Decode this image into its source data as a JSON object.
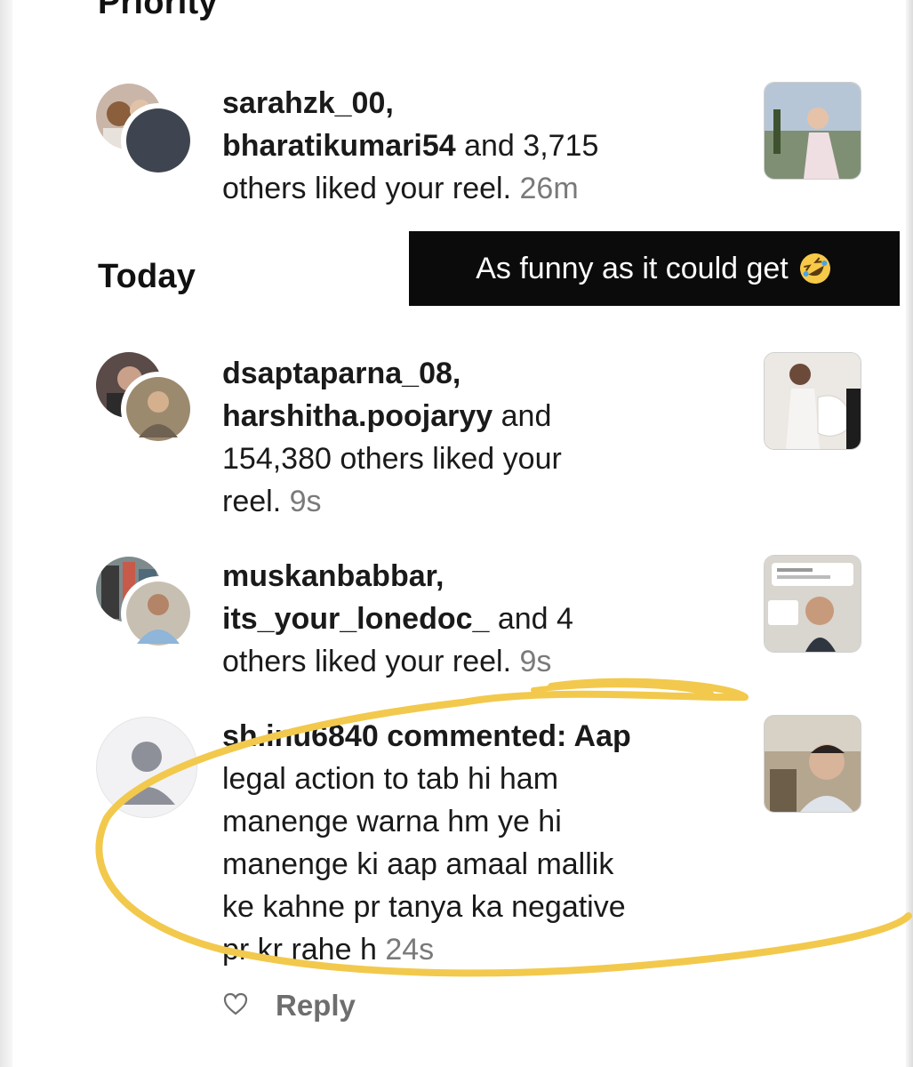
{
  "sections": {
    "priority_title": "Priority",
    "today_title": "Today"
  },
  "caption": {
    "text": "As funny as it could get",
    "emoji_icon": "rolling-on-floor-laughing-icon"
  },
  "notifications": [
    {
      "users": "sarahzk_00,",
      "users2": "bharatikumari54",
      "rest1": " and 3,715",
      "rest2": "others liked your reel.",
      "time": "26m"
    },
    {
      "users": "dsaptaparna_08,",
      "users2": "harshitha.poojaryy",
      "rest1": " and",
      "rest2": "154,380 others liked your",
      "rest3": "reel.",
      "time": "9s"
    },
    {
      "users": "muskanbabbar,",
      "users2": "its_your_lonedoc_",
      "rest1": " and 4",
      "rest2": "others liked your reel.",
      "time": "9s"
    },
    {
      "user": "sh.inu6840",
      "line1_rest": " commented: Aap",
      "line2": "legal action to tab hi ham",
      "line3": "manenge warna hm ye hi",
      "line4": "manenge ki aap amaal mallik",
      "line5": "ke kahne pr tanya ka negative",
      "line6": "pr kr rahe h",
      "time": "24s"
    }
  ],
  "reply": {
    "label": "Reply",
    "like_icon": "heart-outline-icon"
  },
  "colors": {
    "annotation": "#f2c94c",
    "caption_bg": "#0b0b0b",
    "timestamp": "#7a7a7a"
  }
}
